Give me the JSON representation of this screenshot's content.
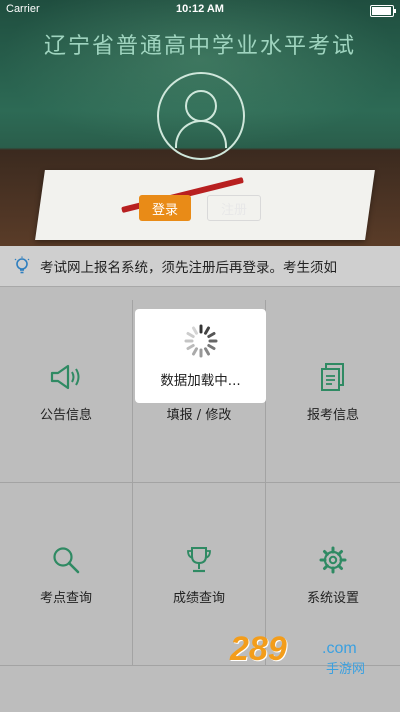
{
  "status_bar": {
    "carrier": "Carrier",
    "time": "10:12 AM"
  },
  "header": {
    "title": "辽宁省普通高中学业水平考试"
  },
  "auth": {
    "login_label": "登录",
    "register_label": "注册"
  },
  "notice": {
    "text": "考试网上报名系统，须先注册后再登录。考生须如",
    "icon": "lightbulb-icon"
  },
  "menu": {
    "items": [
      {
        "label": "公告信息",
        "icon": "megaphone-icon"
      },
      {
        "label": "填报 / 修改",
        "icon": "edit-icon"
      },
      {
        "label": "报考信息",
        "icon": "document-icon"
      },
      {
        "label": "考点查询",
        "icon": "search-icon"
      },
      {
        "label": "成绩查询",
        "icon": "trophy-icon"
      },
      {
        "label": "系统设置",
        "icon": "gear-icon"
      }
    ]
  },
  "loading": {
    "text": "数据加载中..."
  },
  "watermark": {
    "logo": "289",
    "domain": ".com",
    "subtitle": "手游网"
  },
  "colors": {
    "accent_green": "#2f8a63",
    "login_orange": "#e98b17"
  }
}
